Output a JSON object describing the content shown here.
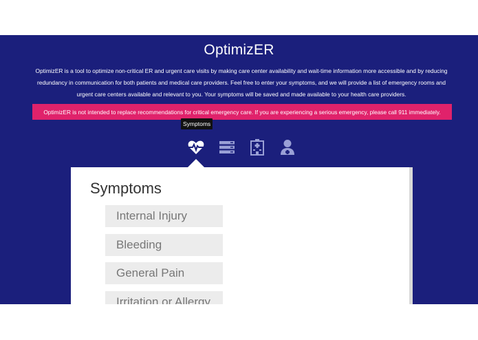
{
  "header": {
    "title": "OptimizER",
    "description": "OptimizER is a tool to optimize non-critical ER and urgent care visits by making care center availability and wait-time information more accessible and by reducing redundancy in communication for both patients and medical care providers. Feel free to enter your symptoms, and we will provide a list of emergency rooms and urgent care centers available and relevant to you. Your symptoms will be saved and made available to your health care providers.",
    "warning": "OptimizER is not intended to replace recommendations for critical emergency care. If you are experiencing a serious emergency, please call 911 immediately."
  },
  "nav": {
    "tooltip": "Symptoms",
    "icons": [
      {
        "name": "heartbeat-icon",
        "active": true
      },
      {
        "name": "server-list-icon",
        "active": false
      },
      {
        "name": "hospital-icon",
        "active": false
      },
      {
        "name": "doctor-icon",
        "active": false
      }
    ]
  },
  "panel": {
    "title": "Symptoms",
    "items": [
      "Internal Injury",
      "Bleeding",
      "General Pain",
      "Irritation or Allergy"
    ]
  },
  "colors": {
    "band": "#1b1f7c",
    "warning": "#e0226b",
    "icon_inactive": "#9aa0d6"
  }
}
